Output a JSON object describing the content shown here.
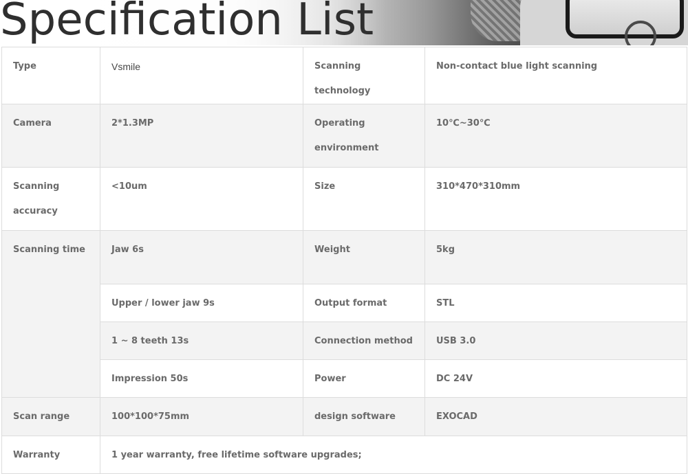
{
  "header": {
    "title": "Specification List"
  },
  "rows": [
    {
      "label": "Type",
      "value": "Vsmile",
      "label2": "Scanning technology",
      "value2": "Non-contact blue light scanning"
    },
    {
      "label": "Camera",
      "value": "2*1.3MP",
      "label2": "Operating environment",
      "value2": "10℃~30℃"
    },
    {
      "label": "Scanning accuracy",
      "value": "<10um",
      "label2": "Size",
      "value2": "310*470*310mm"
    },
    {
      "label": "Scanning time",
      "value": "Jaw 6s",
      "label2": "Weight",
      "value2": "5kg"
    },
    {
      "value": "Upper / lower jaw 9s",
      "label2": "Output format",
      "value2": "STL"
    },
    {
      "value": "1 ~ 8 teeth 13s",
      "label2": "Connection method",
      "value2": "USB 3.0"
    },
    {
      "value": "Impression 50s",
      "label2": "Power",
      "value2": "DC 24V"
    },
    {
      "label": "Scan range",
      "value": "100*100*75mm",
      "label2": "design software",
      "value2": "EXOCAD"
    },
    {
      "label": "Warranty",
      "value": "1 year warranty, free lifetime software upgrades;"
    }
  ]
}
